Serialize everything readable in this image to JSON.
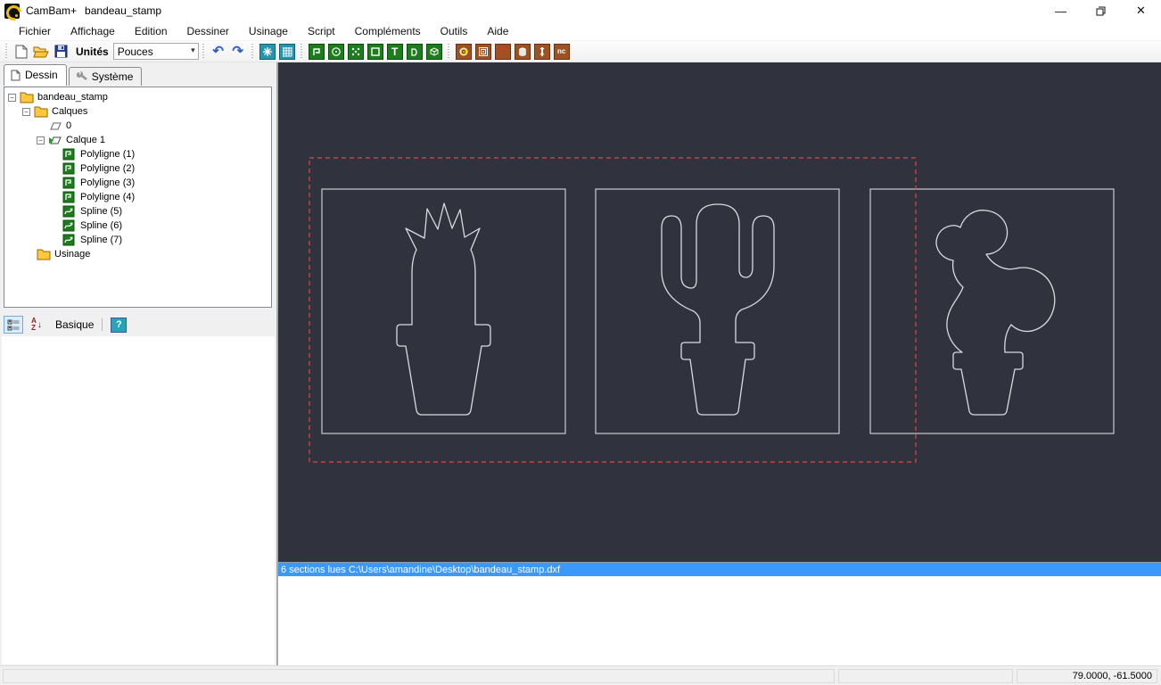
{
  "window": {
    "app_title": "CamBam+",
    "doc_title": "bandeau_stamp"
  },
  "menu": {
    "items": [
      "Fichier",
      "Affichage",
      "Edition",
      "Dessiner",
      "Usinage",
      "Script",
      "Compléments",
      "Outils",
      "Aide"
    ]
  },
  "toolbar": {
    "units_label": "Unités",
    "units_value": "Pouces",
    "undo_glyph": "↶",
    "redo_glyph": "↷",
    "combo_arrow": "▾",
    "text_tool_glyph": "T",
    "nc_tool_glyph": "nc"
  },
  "tabs": {
    "drawing": "Dessin",
    "system": "Système"
  },
  "tree": {
    "items": [
      {
        "label": "bandeau_stamp",
        "icon": "folder"
      },
      {
        "label": "Calques",
        "icon": "folder"
      },
      {
        "label": "0",
        "icon": "layer"
      },
      {
        "label": "Calque 1",
        "icon": "layer-active"
      },
      {
        "label": "Polyligne (1)",
        "icon": "polyline"
      },
      {
        "label": "Polyligne (2)",
        "icon": "polyline"
      },
      {
        "label": "Polyligne (3)",
        "icon": "polyline"
      },
      {
        "label": "Polyligne (4)",
        "icon": "polyline"
      },
      {
        "label": "Spline (5)",
        "icon": "spline"
      },
      {
        "label": "Spline (6)",
        "icon": "spline"
      },
      {
        "label": "Spline (7)",
        "icon": "spline"
      },
      {
        "label": "Usinage",
        "icon": "folder"
      }
    ],
    "toggle_glyph": "−"
  },
  "props": {
    "view_label": "Basique",
    "sort_a": "A",
    "sort_z": "Z",
    "sort_arrow": "↓",
    "help_glyph": "?"
  },
  "message_bar": {
    "text": "6 sections lues C:\\Users\\amandine\\Desktop\\bandeau_stamp.dxf"
  },
  "statusbar": {
    "coordinates": "79.0000, -61.5000"
  },
  "canvas": {
    "background": "#30333d",
    "outline_color": "#d8dade",
    "box_color": "#c9ccd1",
    "selection_color": "#e24444",
    "shapes": [
      "spiky-cactus-in-pot",
      "saguaro-cactus-in-pot",
      "prickly-pear-cactus-in-pot"
    ]
  },
  "colors": {
    "accent_blue": "#3b99fc",
    "tool_green": "#1d7c1d",
    "tool_brown": "#9c5221",
    "tool_teal": "#2596ad",
    "folder_yellow": "#ffc83d"
  }
}
